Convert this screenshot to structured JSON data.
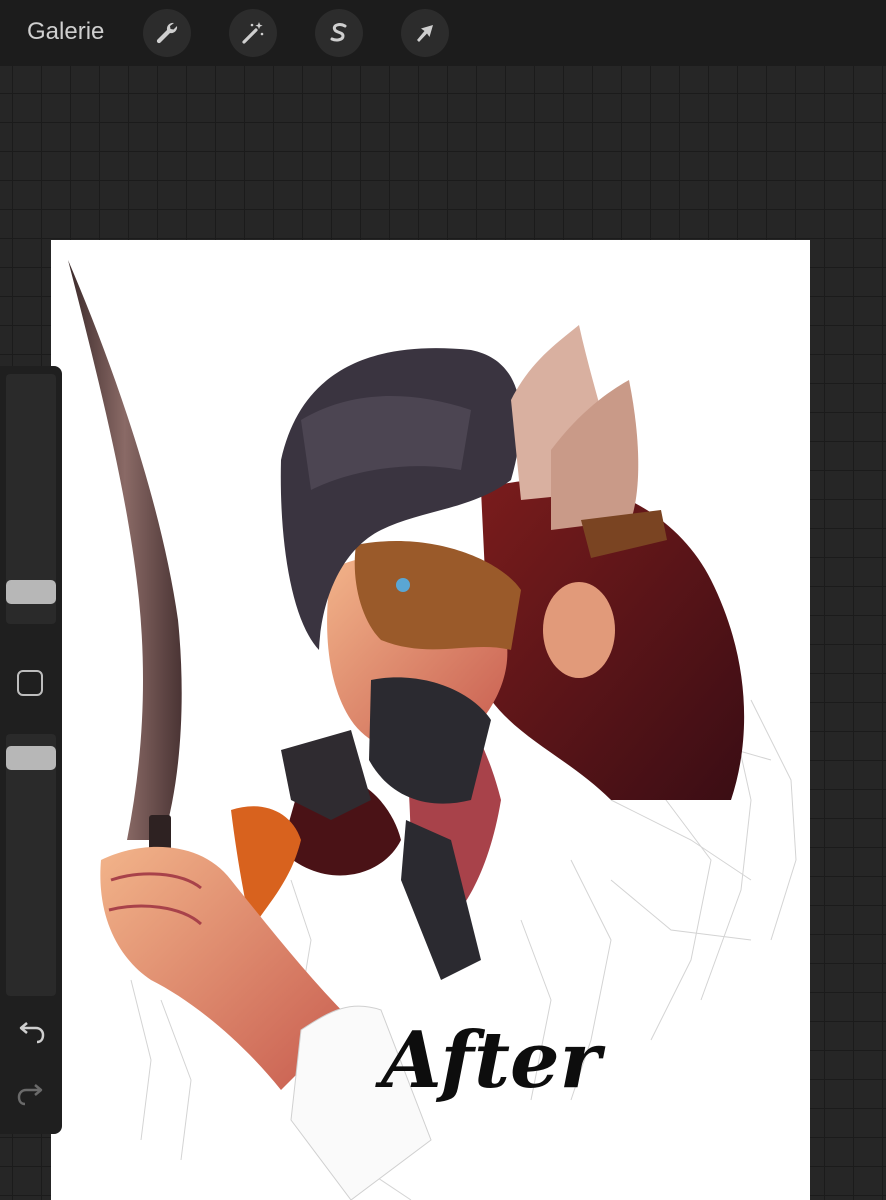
{
  "toolbar": {
    "gallery_label": "Galerie",
    "tools": [
      {
        "name": "actions",
        "icon": "wrench-icon"
      },
      {
        "name": "adjustments",
        "icon": "magic-wand-icon"
      },
      {
        "name": "selection",
        "icon": "selection-s-icon"
      },
      {
        "name": "transform",
        "icon": "arrow-cursor-icon"
      }
    ]
  },
  "sidebar": {
    "brush_size_level": 0.1,
    "opacity_level": 0.93,
    "icons": [
      "square-modify-icon",
      "undo-icon",
      "redo-icon"
    ]
  },
  "artwork": {
    "caption": "After"
  },
  "colors": {
    "ui_bg": "#1c1c1c",
    "canvas_bg": "#ffffff",
    "icon": "#cfcfcf"
  }
}
